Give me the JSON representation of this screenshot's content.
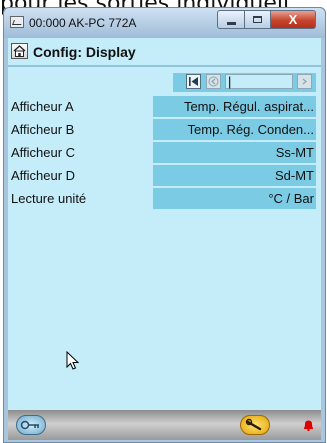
{
  "background": {
    "caption": "pour les sorties individuell"
  },
  "window": {
    "title": "00:000 AK-PC 772A",
    "controls": {
      "close_label": "X"
    }
  },
  "header": {
    "title": "Config: Display"
  },
  "nav": {
    "field_value": "|"
  },
  "rows": [
    {
      "label": "Afficheur A",
      "value": "Temp. Régul. aspirat..."
    },
    {
      "label": "Afficheur B",
      "value": "Temp. Rég. Conden..."
    },
    {
      "label": "Afficheur C",
      "value": "Ss-MT"
    },
    {
      "label": "Afficheur D",
      "value": "Sd-MT"
    },
    {
      "label": "Lecture unité",
      "value": "°C / Bar"
    }
  ],
  "icons": {
    "home": "home-icon",
    "nav_first": "first-page-icon",
    "nav_prev": "previous-icon",
    "nav_next": "next-icon",
    "key": "key-icon",
    "tool": "wrench-icon",
    "alarm": "bell-icon"
  },
  "colors": {
    "client_bg": "#c4ecf9",
    "value_bg": "#7ccbe4",
    "close_button": "#c7452d",
    "alarm": "#e00000"
  }
}
